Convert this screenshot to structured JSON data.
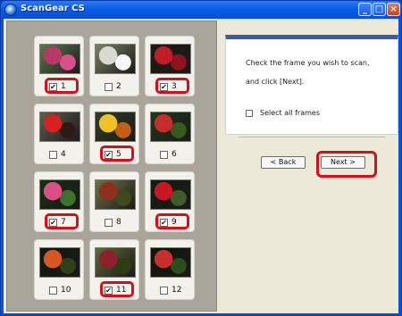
{
  "window": {
    "title": "ScanGear CS",
    "minimize_icon": "minimize-icon",
    "maximize_icon": "maximize-icon",
    "close_icon": "close-icon"
  },
  "frames": [
    {
      "number": "1",
      "checked": true,
      "highlighted": true,
      "photo_colors": [
        "#b53a67",
        "#d7508c",
        "#5d7a4b"
      ]
    },
    {
      "number": "2",
      "checked": false,
      "highlighted": false,
      "photo_colors": [
        "#d9d9d2",
        "#f6f6f6",
        "#7a8363"
      ]
    },
    {
      "number": "3",
      "checked": true,
      "highlighted": true,
      "photo_colors": [
        "#c11b23",
        "#8d151a",
        "#1e1a14"
      ]
    },
    {
      "number": "4",
      "checked": false,
      "highlighted": false,
      "photo_colors": [
        "#d42121",
        "#2c1b14",
        "#5f5d4e"
      ]
    },
    {
      "number": "5",
      "checked": true,
      "highlighted": true,
      "photo_colors": [
        "#f1c125",
        "#c35e12",
        "#2d3f21"
      ]
    },
    {
      "number": "6",
      "checked": false,
      "highlighted": false,
      "photo_colors": [
        "#c52c2c",
        "#365920",
        "#213714"
      ]
    },
    {
      "number": "7",
      "checked": true,
      "highlighted": true,
      "photo_colors": [
        "#d94f86",
        "#3d722c",
        "#162f10"
      ]
    },
    {
      "number": "8",
      "checked": false,
      "highlighted": false,
      "photo_colors": [
        "#8f2f20",
        "#3e4a1d",
        "#6e7441"
      ]
    },
    {
      "number": "9",
      "checked": true,
      "highlighted": true,
      "photo_colors": [
        "#c91625",
        "#3f5b2a",
        "#121c0d"
      ]
    },
    {
      "number": "10",
      "checked": false,
      "highlighted": false,
      "photo_colors": [
        "#d55723",
        "#2e401c",
        "#0f1a0b"
      ]
    },
    {
      "number": "11",
      "checked": true,
      "highlighted": true,
      "photo_colors": [
        "#8e1f2c",
        "#2c3d16",
        "#5d6a33"
      ]
    },
    {
      "number": "12",
      "checked": false,
      "highlighted": false,
      "photo_colors": [
        "#cb2d2d",
        "#2b4d1a",
        "#0c1508"
      ]
    }
  ],
  "panel": {
    "line1": "Check the frame you wish to scan,",
    "line2": "and click [Next].",
    "select_all_label": "Select all frames",
    "back_label": "< Back",
    "next_label": "Next >"
  },
  "colors": {
    "titlebar": "#0c5ae6",
    "highlight": "#d5101b",
    "panel_accent": "#3a5bb5"
  }
}
